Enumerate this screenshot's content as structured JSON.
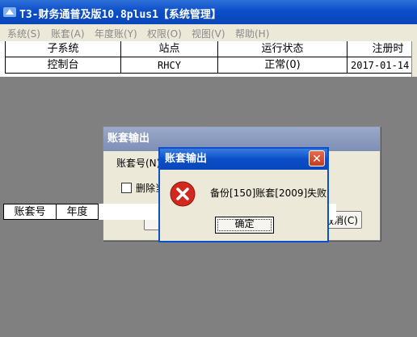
{
  "window": {
    "title": "T3-财务通普及版10.8plus1【系统管理】"
  },
  "menu": [
    {
      "label": "系统(S)"
    },
    {
      "label": "账套(A)"
    },
    {
      "label": "年度账(Y)"
    },
    {
      "label": "权限(O)"
    },
    {
      "label": "视图(V)"
    },
    {
      "label": "帮助(H)"
    }
  ],
  "table": {
    "headers": [
      "子系统",
      "站点",
      "运行状态",
      "注册时"
    ],
    "rows": [
      [
        "控制台",
        "RHCY",
        "正常(0)",
        "2017-01-14"
      ]
    ]
  },
  "lower_table": {
    "headers": [
      "账套号",
      "年度"
    ]
  },
  "export_dialog": {
    "title": "账套输出",
    "account_label": "账套号(N)",
    "delete_label": "删除当",
    "cancel_label": "取消(C)"
  },
  "message_box": {
    "title": "账套输出",
    "message": "备份[150]账套[2009]失败",
    "ok_label": "确定",
    "close_glyph": "✕"
  },
  "colors": {
    "titlebar": "#0b4fc9",
    "error": "#d2281e",
    "workspace": "#808080"
  }
}
